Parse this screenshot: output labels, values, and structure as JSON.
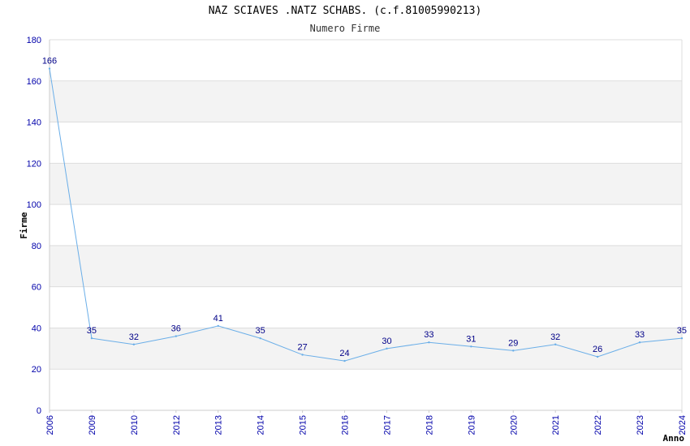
{
  "chart_data": {
    "type": "line",
    "title": "NAZ SCIAVES .NATZ SCHABS. (c.f.81005990213)",
    "subtitle": "Numero Firme",
    "xlabel": "Anno",
    "ylabel": "Firme",
    "ylim": [
      0,
      180
    ],
    "yticks": [
      "0",
      "20",
      "40",
      "60",
      "80",
      "100",
      "120",
      "140",
      "160",
      "180"
    ],
    "categories": [
      "2006",
      "2009",
      "2010",
      "2012",
      "2013",
      "2014",
      "2015",
      "2016",
      "2017",
      "2018",
      "2019",
      "2020",
      "2021",
      "2022",
      "2023",
      "2024"
    ],
    "values": [
      166,
      35,
      32,
      36,
      41,
      35,
      27,
      24,
      30,
      33,
      31,
      29,
      32,
      26,
      33,
      35
    ],
    "grid": true,
    "colors": {
      "line": "#6aaee8",
      "tick_text": "#0000aa",
      "label_text": "#000088",
      "band": "#f3f3f3",
      "grid": "#dddddd"
    }
  }
}
